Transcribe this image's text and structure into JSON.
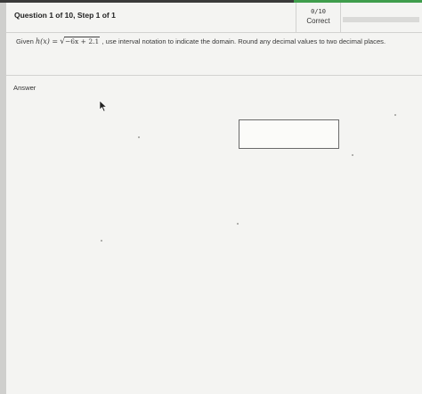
{
  "header": {
    "step_title": "Question 1 of 10, Step 1 of 1",
    "score": "0/10",
    "score_status": "Correct",
    "progress_fraction": 0.0
  },
  "question": {
    "prefix": "Given ",
    "function_lhs": "h(x) =",
    "radical_symbol": "√",
    "radicand": "−6x + 2.1",
    "suffix": ", use interval notation to indicate the domain. Round any decimal values to two decimal places."
  },
  "answer": {
    "label": "Answer",
    "value": ""
  },
  "colors": {
    "accent": "#3f9d4c",
    "panel_background": "#f4f4f2"
  }
}
